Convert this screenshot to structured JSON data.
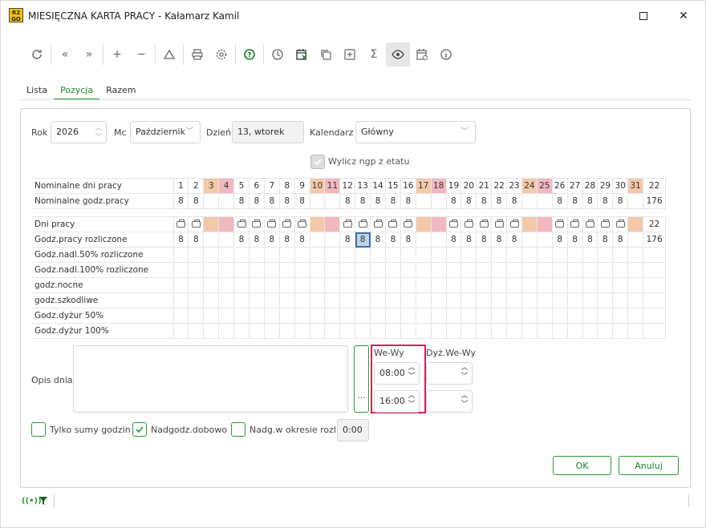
{
  "window": {
    "app_icon": "R2\nGO",
    "title": "MIESIĘCZNA KARTA PRACY - Kałamarz Kamil"
  },
  "tabs": [
    "Lista",
    "Pozycja",
    "Razem"
  ],
  "form": {
    "year_label": "Rok",
    "year_value": "2026",
    "month_label": "Mc",
    "month_value": "Październik",
    "day_label": "Dzień",
    "day_value": "13, wtorek",
    "calendar_label": "Kalendarz",
    "calendar_value": "Główny",
    "calc_ngp_label": "Wylicz ngp z etatu"
  },
  "nominal": {
    "row1_label": "Nominalne dni pracy",
    "row2_label": "Nominalne godz.pracy",
    "days": [
      "1",
      "2",
      "3",
      "4",
      "5",
      "6",
      "7",
      "8",
      "9",
      "10",
      "11",
      "12",
      "13",
      "14",
      "15",
      "16",
      "17",
      "18",
      "19",
      "20",
      "21",
      "22",
      "23",
      "24",
      "25",
      "26",
      "27",
      "28",
      "29",
      "30",
      "31"
    ],
    "day_types": [
      "w",
      "w",
      "s",
      "h",
      "w",
      "w",
      "w",
      "w",
      "w",
      "s",
      "h",
      "w",
      "w",
      "w",
      "w",
      "w",
      "s",
      "h",
      "w",
      "w",
      "w",
      "w",
      "w",
      "s",
      "h",
      "w",
      "w",
      "w",
      "w",
      "w",
      "s"
    ],
    "hours": [
      "8",
      "8",
      "",
      "",
      "8",
      "8",
      "8",
      "8",
      "8",
      "",
      "",
      "8",
      "8",
      "8",
      "8",
      "8",
      "",
      "",
      "8",
      "8",
      "8",
      "8",
      "8",
      "",
      "",
      "8",
      "8",
      "8",
      "8",
      "8",
      ""
    ],
    "days_total": "22",
    "hours_total": "176"
  },
  "work": {
    "rows": [
      "Dni pracy",
      "Godz.pracy rozliczone",
      "Godz.nadl.50% rozliczone",
      "Godz.nadl.100% rozliczone",
      "godz.nocne",
      "godz.szkodliwe",
      "Godz.dyżur 50%",
      "Godz.dyżur 100%"
    ],
    "hours": [
      "8",
      "8",
      "",
      "",
      "8",
      "8",
      "8",
      "8",
      "8",
      "",
      "",
      "8",
      "8",
      "8",
      "8",
      "8",
      "",
      "",
      "8",
      "8",
      "8",
      "8",
      "8",
      "",
      "",
      "8",
      "8",
      "8",
      "8",
      "8",
      ""
    ],
    "days_total": "22",
    "hours_total": "176",
    "selected_day": "13"
  },
  "description": {
    "label": "Opis dnia",
    "dots": "..."
  },
  "times": {
    "we_wy_label": "We-Wy",
    "in_value": "08:00",
    "out_value": "16:00",
    "duty_label": "Dyż.We-Wy"
  },
  "checkboxes": {
    "only_sums": "Tylko sumy godzin",
    "overtime_daily": "Nadgodz.dobowo",
    "overtime_period": "Nadg.w okresie rozl.",
    "period_value": "0:00"
  },
  "buttons": {
    "ok": "OK",
    "cancel": "Anuluj"
  },
  "colors": {
    "accent": "#2a9a33",
    "weekend": "#f3c9a9",
    "holiday": "#f2b8bf",
    "highlight": "#e0195a"
  }
}
